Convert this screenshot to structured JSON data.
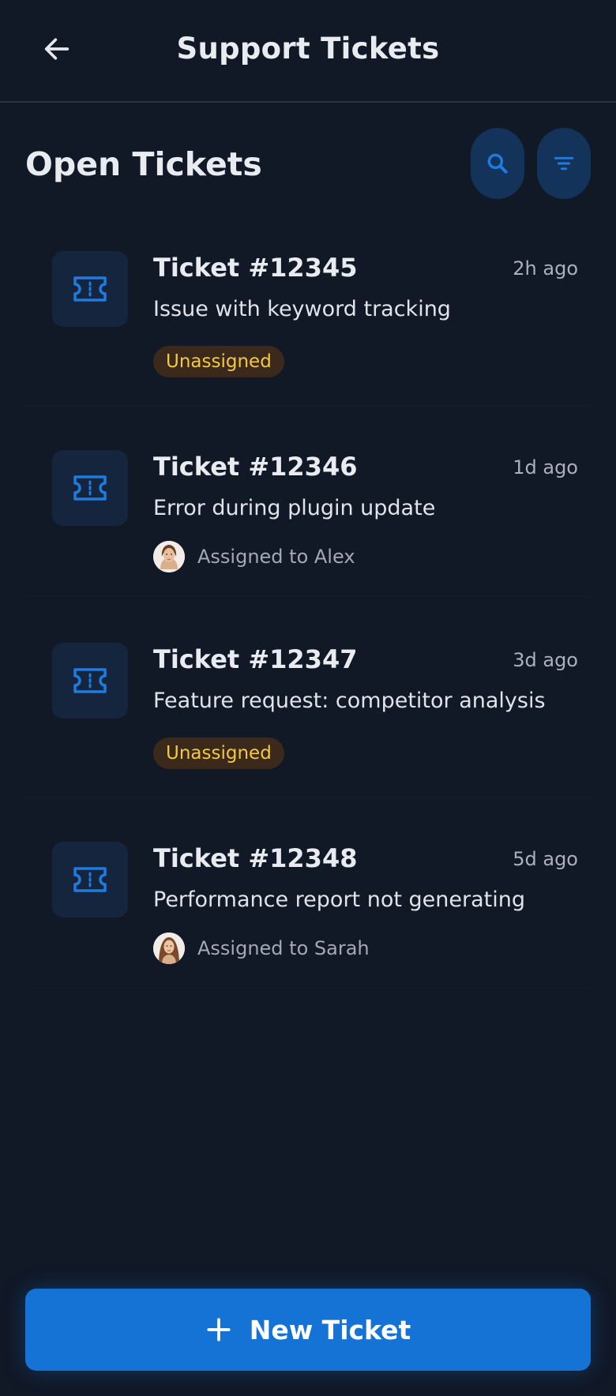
{
  "header": {
    "title": "Support Tickets",
    "back_icon": "arrow-left-icon"
  },
  "section": {
    "title": "Open Tickets",
    "search_icon": "search-icon",
    "filter_icon": "filter-icon"
  },
  "tickets": [
    {
      "id": "Ticket #12345",
      "time": "2h ago",
      "subject": "Issue with keyword tracking",
      "status": "Unassigned",
      "assignee": ""
    },
    {
      "id": "Ticket #12346",
      "time": "1d ago",
      "subject": "Error during plugin update",
      "status": "",
      "assignee": "Assigned to Alex"
    },
    {
      "id": "Ticket #12347",
      "time": "3d ago",
      "subject": "Feature request: competitor analysis",
      "status": "Unassigned",
      "assignee": ""
    },
    {
      "id": "Ticket #12348",
      "time": "5d ago",
      "subject": "Performance report not generating",
      "status": "",
      "assignee": "Assigned to Sarah"
    }
  ],
  "actions": {
    "new_ticket_label": "New Ticket",
    "new_ticket_icon": "plus-icon"
  },
  "colors": {
    "background": "#111826",
    "accent": "#1573d6",
    "icon_blue": "#1e7be0",
    "badge_text": "#f4c842",
    "badge_bg": "#3b2a1c"
  }
}
